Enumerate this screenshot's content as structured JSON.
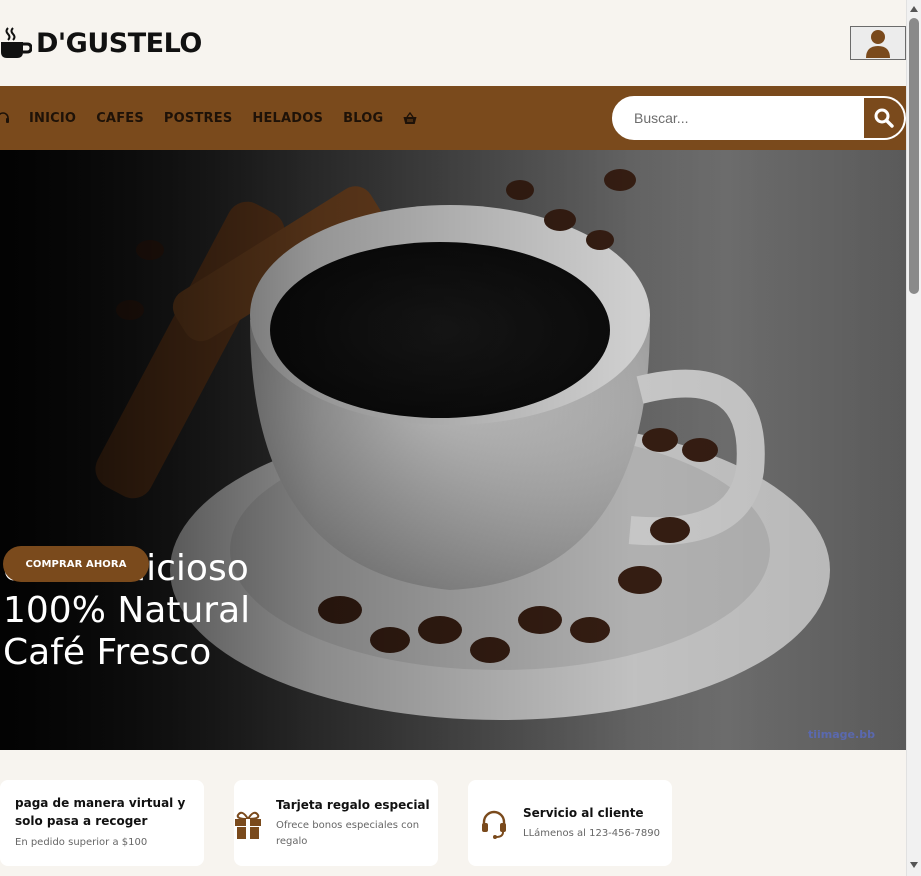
{
  "brand": {
    "name": "D'GUSTELO",
    "icon": "coffee-cup-icon"
  },
  "header": {
    "user_icon": "user-icon"
  },
  "nav": {
    "items": [
      {
        "label": "INICIO"
      },
      {
        "label": "CAFES"
      },
      {
        "label": "POSTRES"
      },
      {
        "label": "HELADOS"
      },
      {
        "label": "BLOG"
      }
    ],
    "leading_icon": "headset-icon",
    "cart_icon": "basket-icon"
  },
  "search": {
    "placeholder": "Buscar...",
    "icon": "search-icon"
  },
  "hero": {
    "lines": [
      "cafe delicioso",
      "100% Natural",
      "Café Fresco"
    ],
    "cta": "COMPRAR AHORA",
    "watermark": "tiimage.bb"
  },
  "features": [
    {
      "title": "paga de manera virtual y solo pasa a recoger",
      "desc": "En pedido superior a $100",
      "icon": ""
    },
    {
      "title": "Tarjeta regalo especial",
      "desc": "Ofrece bonos especiales con regalo",
      "icon": "gift-icon"
    },
    {
      "title": "Servicio al cliente",
      "desc": "LLámenos al 123-456-7890",
      "icon": "headset-icon"
    }
  ],
  "colors": {
    "accent": "#7a4a1c",
    "background": "#f7f4ef",
    "card": "#ffffff"
  }
}
